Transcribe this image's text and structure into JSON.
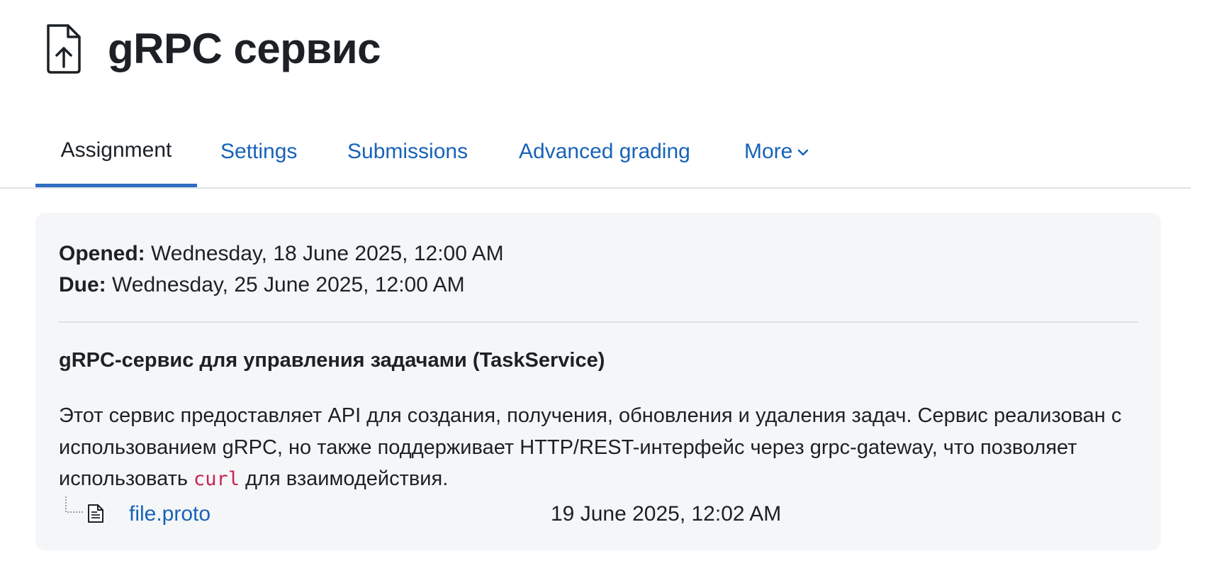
{
  "header": {
    "title": "gRPC сервис",
    "icon": "file-upload-icon"
  },
  "tabs": [
    {
      "label": "Assignment",
      "active": true
    },
    {
      "label": "Settings",
      "active": false
    },
    {
      "label": "Submissions",
      "active": false
    },
    {
      "label": "Advanced grading",
      "active": false
    },
    {
      "label": "More",
      "active": false,
      "icon": "chevron-down-icon"
    }
  ],
  "dates": {
    "opened_label": "Opened:",
    "opened_value": "Wednesday, 18 June 2025, 12:00 AM",
    "due_label": "Due:",
    "due_value": "Wednesday, 25 June 2025, 12:00 AM"
  },
  "description": {
    "title": "gRPC-сервис для управления задачами (TaskService)",
    "text_before": "Этот сервис предоставляет API для создания, получения, обновления и удаления задач. Сервис реализован с использованием gRPC, но также поддерживает HTTP/REST-интерфейс через grpc-gateway, что позволяет использовать ",
    "code": "curl",
    "text_after": " для взаимодействия."
  },
  "attachment": {
    "name": "file.proto",
    "date": "19 June 2025, 12:02 AM",
    "icon": "text-file-icon"
  },
  "colors": {
    "link": "#1763b8",
    "accent": "#2f6dc2",
    "card_bg": "#f5f6f8",
    "code": "#c7254e"
  }
}
